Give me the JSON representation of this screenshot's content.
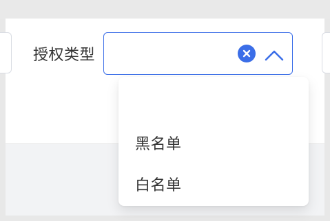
{
  "form": {
    "auth_type_label": "授权类型",
    "auth_type_value": ""
  },
  "dropdown": {
    "options": [
      {
        "label": ""
      },
      {
        "label": "黑名单"
      },
      {
        "label": "白名单"
      }
    ]
  },
  "icons": {
    "clear": "clear-icon",
    "chevron": "chevron-up-icon"
  },
  "colors": {
    "accent": "#3b6ee8",
    "text": "#333333",
    "border": "#d9dce3",
    "frame": "#e8e8e8",
    "bottom_area": "#f2f3f5"
  }
}
